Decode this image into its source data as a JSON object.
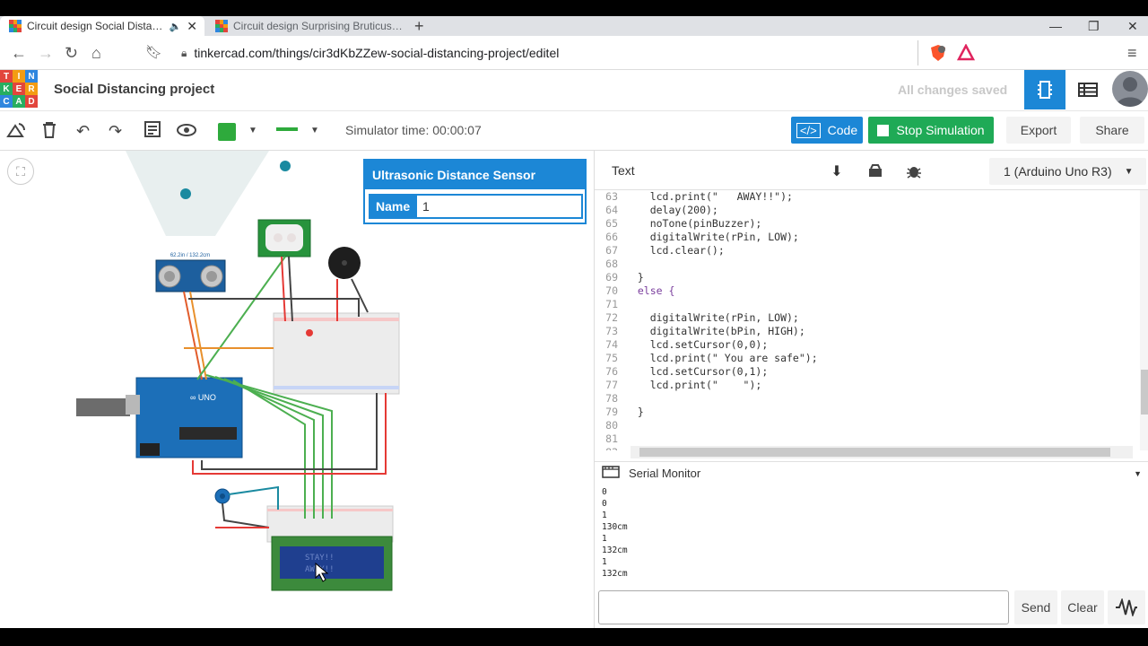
{
  "browser": {
    "tabs": [
      {
        "title": "Circuit design Social Distanci",
        "active": true
      },
      {
        "title": "Circuit design Surprising Bruticus | Tin",
        "active": false
      }
    ],
    "url": "tinkercad.com/things/cir3dKbZZew-social-distancing-project/editel"
  },
  "app": {
    "logo_letters": [
      "T",
      "I",
      "N",
      "K",
      "E",
      "R",
      "C",
      "A",
      "D"
    ],
    "project_title": "Social Distancing project",
    "save_status": "All changes saved"
  },
  "toolbar": {
    "simulator_time": "Simulator time: 00:00:07",
    "code_label": "Code",
    "stop_label": "Stop Simulation",
    "export_label": "Export",
    "share_label": "Share",
    "shape_color": "#2eaa3c"
  },
  "inspector": {
    "title": "Ultrasonic Distance Sensor",
    "name_label": "Name",
    "name_value": "1"
  },
  "circuit": {
    "sensor_label": "62.2in / 132.2cm",
    "lcd_text": "STAY!! AWAY!!"
  },
  "code": {
    "mode": "Text",
    "device": "1 (Arduino Uno R3)",
    "lines": [
      {
        "n": "63",
        "text": "    lcd.print(\"   AWAY!!\");"
      },
      {
        "n": "64",
        "text": "    delay(200);"
      },
      {
        "n": "65",
        "text": "    noTone(pinBuzzer);"
      },
      {
        "n": "66",
        "text": "    digitalWrite(rPin, LOW);"
      },
      {
        "n": "67",
        "text": "    lcd.clear();"
      },
      {
        "n": "68",
        "text": ""
      },
      {
        "n": "69",
        "text": "  }"
      },
      {
        "n": "70",
        "text": "  else {"
      },
      {
        "n": "71",
        "text": ""
      },
      {
        "n": "72",
        "text": "    digitalWrite(rPin, LOW);"
      },
      {
        "n": "73",
        "text": "    digitalWrite(bPin, HIGH);"
      },
      {
        "n": "74",
        "text": "    lcd.setCursor(0,0);"
      },
      {
        "n": "75",
        "text": "    lcd.print(\" You are safe\");"
      },
      {
        "n": "76",
        "text": "    lcd.setCursor(0,1);"
      },
      {
        "n": "77",
        "text": "    lcd.print(\"    \");"
      },
      {
        "n": "78",
        "text": ""
      },
      {
        "n": "79",
        "text": "  }"
      },
      {
        "n": "80",
        "text": ""
      },
      {
        "n": "81",
        "text": ""
      },
      {
        "n": "82",
        "text": ""
      }
    ]
  },
  "serial": {
    "title": "Serial Monitor",
    "output": [
      "0",
      "0",
      "1",
      "130cm",
      "1",
      "132cm",
      "1",
      "132cm"
    ],
    "send_label": "Send",
    "clear_label": "Clear"
  }
}
